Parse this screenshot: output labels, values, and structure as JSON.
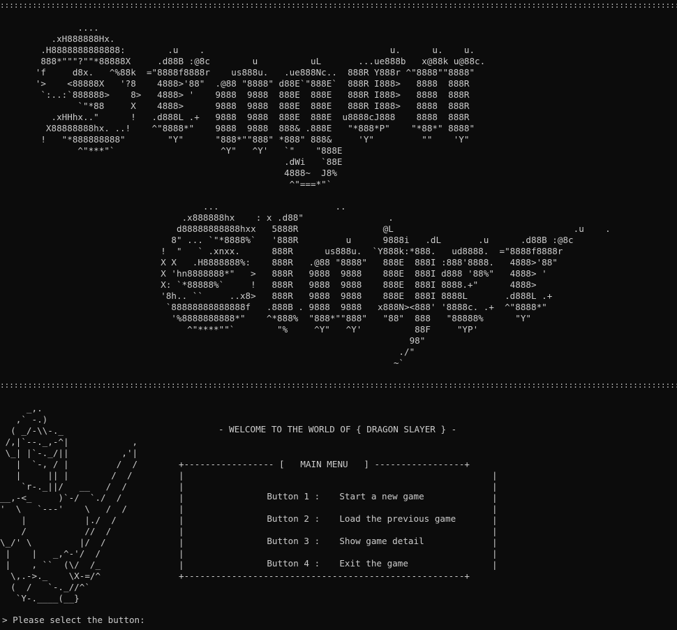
{
  "colors": {
    "background": "#0c0c0c",
    "text": "#cccccc"
  },
  "separator": "::::::::::::::::::::::::::::::::::::::::::::::::::::::::::::::::::::::::::::::::::::::::::::::::::::::::::::::::::::::::::::::::::::::::::::::::::::::::::::::::::::::::::::",
  "banner_line_1": "           ....\n      .xH888888Hx.\n    .H8888888888888:        .u    .                                   u.      u.    u.\n    888*\"\"\"?\"\"*88888X     .d88B :@8c        u          uL       ...ue888b   x@88k u@88c.\n   'f     d8x.   ^%88k  =\"8888f8888r    us888u.   .ue888Nc..  888R Y888r ^\"8888\"\"8888\"\n   '>    <88888X   '?8    4888>'88\"  .@88 \"8888\" d88E`\"888E`  888R I888>   8888  888R\n    `:..:`888888>    8>   4888> '    9888  9888  888E  888E   888R I888>   8888  888R\n           `\"*88     X    4888>      9888  9888  888E  888E   888R I888>   8888  888R\n      .xHHhx..\"      !   .d888L .+   9888  9888  888E  888E  u8888cJ888    8888  888R\n     X88888888hx. ..!    ^\"8888*\"    9888  9888  888& .888E   \"*888*P\"    \"*88*\" 8888\"\n    !   \"*888888888\"        \"Y\"      \"888*\"\"888\" *888\" 888&     'Y\"         \"\"    'Y\"\n           ^\"***\"`                    ^Y\"   ^Y'   `\"    \"888E\n                                                  .dWi   `88E\n                                                  4888~  J8%\n                                                   ^\"===*\"`",
  "banner_line_2": "                 ...                      ..\n             .x888888hx    : x .d88\"                .\n            d88888888888hxx   5888R                @L                                  .u    .\n           8\" ... `\"*8888%`   '888R         u      9888i   .dL       .u      .d88B :@8c\n         !  \"   ` .xnxx.      888R      us888u.  `Y888k:*888.   ud8888.  =\"8888f8888r\n         X X   .H8888888%:    888R   .@88 \"8888\"   888E  888I :888'8888.   4888>'88\"\n         X 'hn8888888*\"   >   888R   9888  9888    888E  888I d888 '88%\"   4888> '\n         X: `*88888%`     !   888R   9888  9888    888E  888I 8888.+\"      4888>\n         '8h.. ``     ..x8>   888R   9888  9888    888E  888I 8888L       .d888L .+\n          `88888888888888f   .888B . 9888  9888   x888N><888' '8888c. .+  ^\"8888*\"\n           '%8888888888*\"    ^*888%  \"888*\"\"888\"   \"88\"  888   \"88888%      \"Y\"\n              ^\"****\"\"`        \"%     ^Y\"   ^Y'          88F     \"YP'\n                                                        98\"\n                                                      ./\"\n                                                     ~`",
  "knight_art": "     _,.\n   ,` -.)\n  ( _/-\\\\-._\n /,|`--._,-^|            ,\n \\_| |`-._/||          ,'|\n   |  `-, / |         /  /\n   |     || |        /  /\n    `r-._||/   __   /  /\n__,-<_     )`-/  `./  /\n'  \\   `---'    \\   /  /\n    |           |./  /\n    /           //  /\n\\_/' \\         |/  /\n |    |   _,^-'/  /\n |    , ``  (\\/  /_\n  \\,.->._    \\X-=/^\n  (  /   `-._//^`\n   `Y-.____(__}",
  "welcome_text": "- WELCOME TO THE WORLD OF { DRAGON SLAYER } -",
  "menu": {
    "top_border": "+----------------- [   MAIN MENU   ] -----------------+",
    "bottom_border": "+-----------------------------------------------------+",
    "side": "|",
    "buttons": [
      {
        "label": "Button 1 :",
        "action": "Start a new game"
      },
      {
        "label": "Button 2 :",
        "action": "Load the previous game"
      },
      {
        "label": "Button 3 :",
        "action": "Show game detail"
      },
      {
        "label": "Button 4 :",
        "action": "Exit the game"
      }
    ]
  },
  "prompt_text": "> Please select the button:"
}
